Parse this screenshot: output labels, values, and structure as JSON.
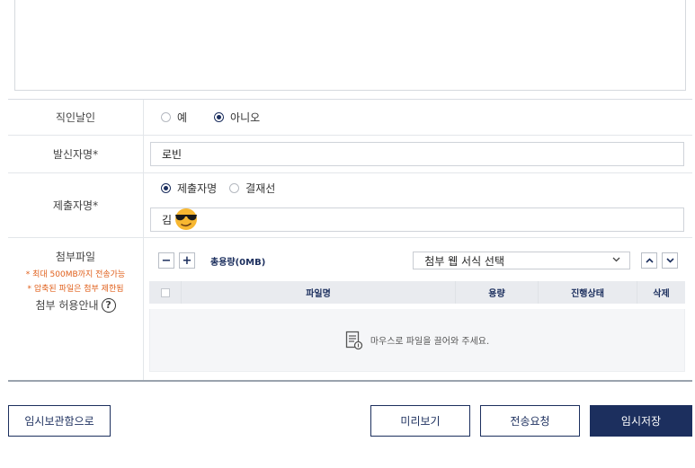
{
  "form": {
    "row_direct": {
      "label": "직인날인",
      "options": [
        {
          "label": "예",
          "selected": false
        },
        {
          "label": "아니오",
          "selected": true
        }
      ]
    },
    "row_sender": {
      "label": "발신자명*",
      "value": "로빈"
    },
    "row_submitter": {
      "label": "제출자명*",
      "options": [
        {
          "label": "제출자명",
          "selected": true
        },
        {
          "label": "결재선",
          "selected": false
        }
      ],
      "value": "김"
    },
    "row_attach": {
      "label": "첨부파일",
      "note1": "* 최대 500MB까지 전송가능",
      "note2": "* 압축된 파일은 첨부 제한됨",
      "guide": "첨부 허용안내",
      "help_icon": "?",
      "minus": "−",
      "plus": "+",
      "total_size": "총용량(0MB)",
      "template_select": "첨부 웹 서식 선택",
      "table_headers": {
        "name": "파일명",
        "size": "용량",
        "status": "진행상태",
        "delete": "삭제"
      },
      "dropzone_text": "마우스로 파일을 끌어와 주세요."
    }
  },
  "buttons": {
    "temp_box": "임시보관함으로",
    "preview": "미리보기",
    "send_request": "전송요청",
    "temp_save": "임시저장"
  },
  "icons": {
    "select_chevron": "chevron-down-icon",
    "up": "chevron-up-icon",
    "down": "chevron-down-icon",
    "file": "document-icon",
    "emoji": "sunglasses-face-icon"
  },
  "colors": {
    "primary": "#1c2f5e",
    "note": "#e0601c"
  }
}
